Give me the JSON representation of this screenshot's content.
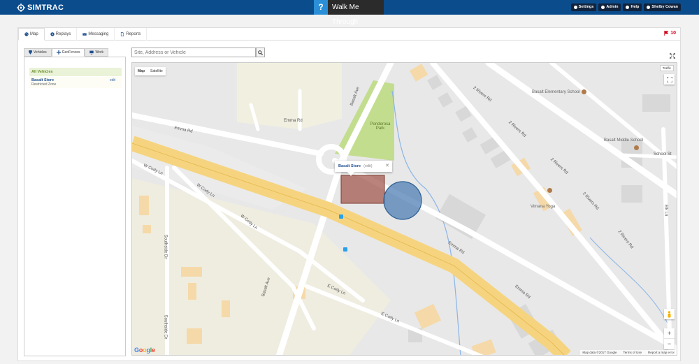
{
  "brand": {
    "name": "SIMTRAC"
  },
  "walkme": {
    "icon": "?",
    "label": "Walk Me Through"
  },
  "topnav": [
    {
      "label": "Settings",
      "icon": "gear-icon"
    },
    {
      "label": "Admin",
      "icon": "user-icon"
    },
    {
      "label": "Help",
      "icon": "help-icon"
    },
    {
      "label": "Shelby Cowan",
      "icon": "user-icon"
    }
  ],
  "tabs": [
    {
      "label": "Map",
      "icon": "globe-icon",
      "active": true
    },
    {
      "label": "Replays",
      "icon": "replay-icon"
    },
    {
      "label": "Messaging",
      "icon": "envelope-icon"
    },
    {
      "label": "Reports",
      "icon": "document-icon"
    }
  ],
  "alerts": {
    "count": "10",
    "icon": "flag-icon",
    "color": "#d0021b"
  },
  "subtabs": [
    {
      "label": "Vehicles",
      "icon": "pin-icon"
    },
    {
      "label": "GeoFences",
      "icon": "crosshair-icon",
      "active": true
    },
    {
      "label": "Work",
      "icon": "monitor-icon"
    }
  ],
  "sidebar": {
    "all_vehicles": "All Vehicles",
    "geofence": {
      "name": "Basalt Store",
      "type": "Restricted Zone",
      "edit": "edit"
    }
  },
  "search": {
    "placeholder": "Site, Address or Vehicle"
  },
  "map": {
    "types": [
      "Map",
      "Satellite"
    ],
    "traffic": "Traffic",
    "infowindow": {
      "name": "Basalt Store",
      "edit": "(edit)",
      "close": "✕"
    },
    "streets": [
      "Emma Rd",
      "Emma Rd",
      "Emma Rd",
      "Emma Rd",
      "Basalt Ave",
      "Basalt Ave",
      "2 Rivers Rd",
      "2 Rivers Rd",
      "2 Rivers Rd",
      "2 Rivers Rd",
      "2 Rivers Rd",
      "W Cody Ln",
      "W Cody Ln",
      "W Cody Ln",
      "E Cody Ln",
      "E Cody Ln",
      "Southside Dr",
      "Southside Dr",
      "School St",
      "Elk Ln"
    ],
    "pois": [
      "Basalt Elementary School",
      "Ponderosa Park",
      "Basalt Middle School",
      "Vimana Yoga"
    ],
    "logo": "Google",
    "attribution": [
      "Map data ©2017 Google",
      "Terms of Use",
      "Report a map error"
    ],
    "zoom_in": "+",
    "zoom_out": "−",
    "colors": {
      "highway": "#f6d47f",
      "park": "#c3dd8f",
      "geofence_polygon": "#a35a4f",
      "vehicle_circle": "#4f7fb3"
    }
  }
}
